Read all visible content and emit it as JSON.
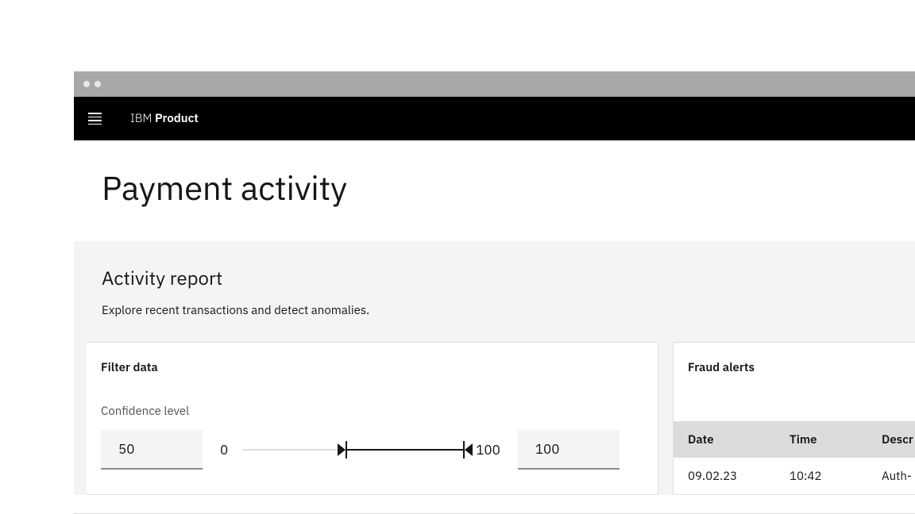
{
  "header": {
    "brand_prefix": "IBM",
    "brand_name": "Product"
  },
  "page": {
    "title": "Payment activity"
  },
  "report": {
    "title": "Activity report",
    "description": "Explore recent transactions and detect anomalies."
  },
  "filter_panel": {
    "heading": "Filter data",
    "label": "Confidence level",
    "min_value": "50",
    "max_value": "100",
    "scale_min": "0",
    "scale_max": "100",
    "slider_lower_pct": 47,
    "slider_upper_pct": 100
  },
  "alerts_panel": {
    "heading": "Fraud alerts",
    "columns": [
      "Date",
      "Time",
      "Descr"
    ],
    "rows": [
      {
        "date": "09.02.23",
        "time": "10:42",
        "desc": "Auth-"
      }
    ]
  }
}
